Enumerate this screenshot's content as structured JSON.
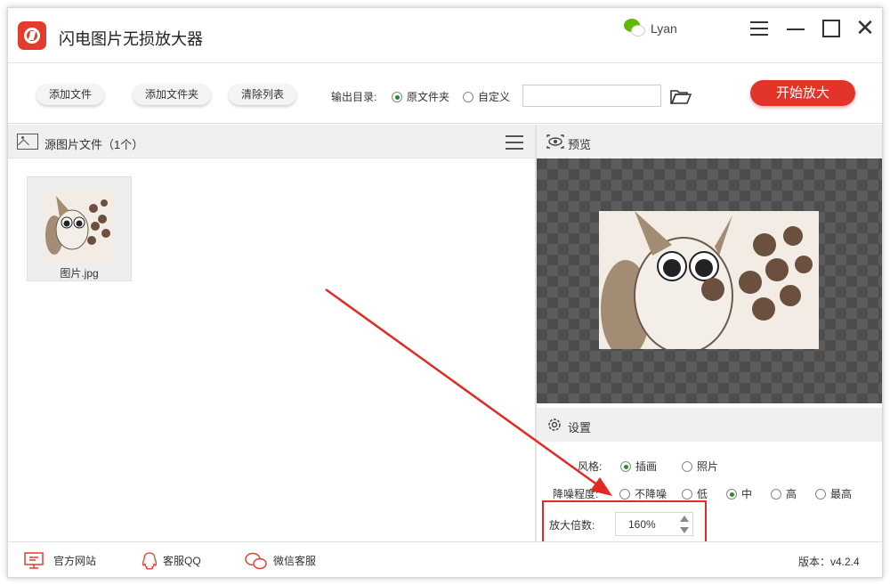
{
  "app": {
    "title": "闪电图片无损放大器",
    "user_name": "Lyan",
    "brand_color": "#e33b2e"
  },
  "toolbar": {
    "add_file": "添加文件",
    "add_folder": "添加文件夹",
    "clear_list": "清除列表",
    "output_label": "输出目录:",
    "output_options": [
      {
        "label": "原文件夹",
        "selected": true
      },
      {
        "label": "自定义",
        "selected": false
      }
    ],
    "output_path_value": "",
    "start_button": "开始放大"
  },
  "left_panel": {
    "title": "源图片文件（1个）",
    "files": [
      {
        "name": "图片.jpg"
      }
    ]
  },
  "preview": {
    "title": "预览"
  },
  "settings": {
    "title": "设置",
    "style_label": "风格:",
    "style_options": [
      {
        "label": "插画",
        "selected": true
      },
      {
        "label": "照片",
        "selected": false
      }
    ],
    "noise_label": "降噪程度:",
    "noise_options": [
      {
        "label": "不降噪",
        "selected": false
      },
      {
        "label": "低",
        "selected": false
      },
      {
        "label": "中",
        "selected": true
      },
      {
        "label": "高",
        "selected": false
      },
      {
        "label": "最高",
        "selected": false
      }
    ],
    "scale_label": "放大倍数:",
    "scale_value": "160%"
  },
  "footer": {
    "website": "官方网站",
    "qq": "客服QQ",
    "wechat": "微信客服",
    "version": "版本：v4.2.4"
  },
  "annotation_color": "#e32a22"
}
